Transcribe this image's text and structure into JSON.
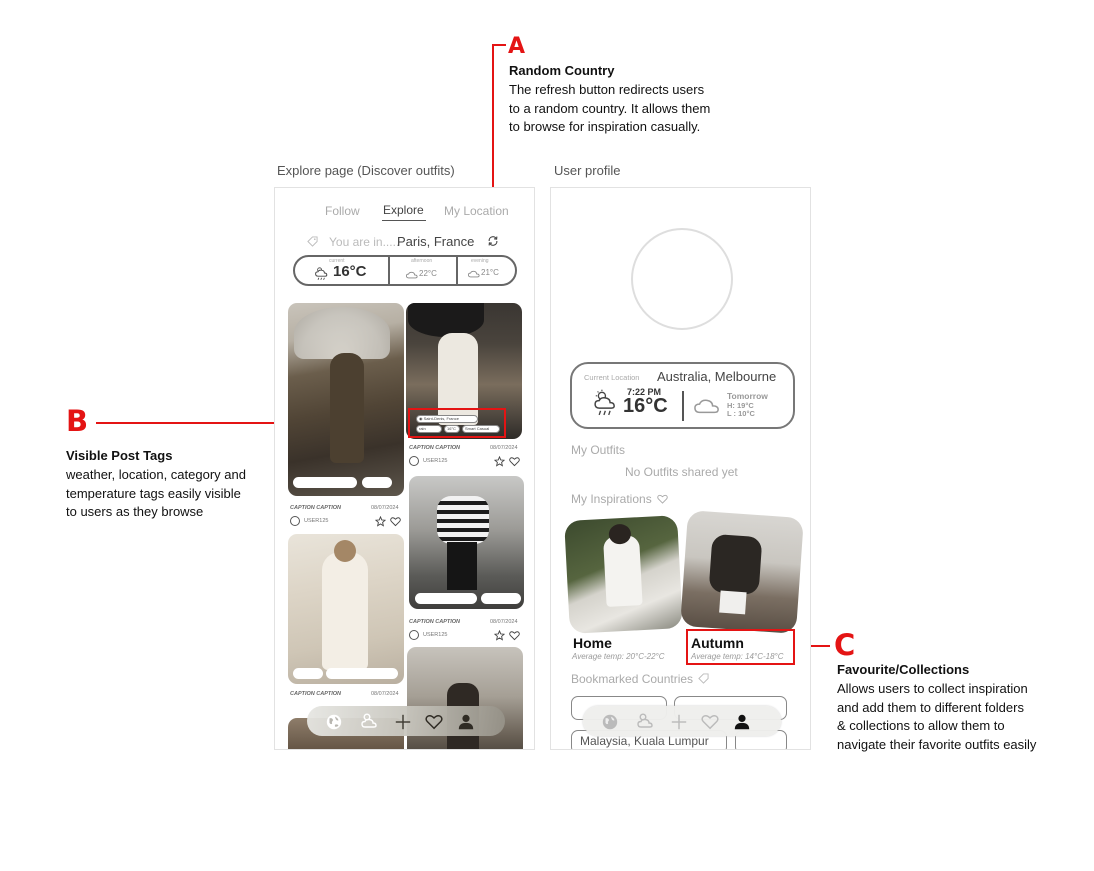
{
  "annotations": {
    "a": {
      "letter": "A",
      "title": "Random Country",
      "lines": [
        "The refresh button redirects users",
        "to a random country. It allows them",
        "to browse for inspiration casually."
      ]
    },
    "b": {
      "letter": "B",
      "title": "Visible Post Tags",
      "lines": [
        "weather, location, category and",
        "temperature tags easily visible",
        "to users as they browse"
      ]
    },
    "c": {
      "letter": "C",
      "title": "Favourite/Collections",
      "lines": [
        "Allows users to collect inspiration",
        "and add them to different folders",
        "& collections to allow them to",
        "navigate their favorite outfits easily"
      ]
    }
  },
  "explore": {
    "panel_label": "Explore page (Discover outfits)",
    "tabs": [
      "Follow",
      "Explore",
      "My Location"
    ],
    "location_prefix": "You are in.....",
    "location": "Paris, France",
    "weather": {
      "current_label": "current",
      "current_temp": "16°C",
      "afternoon_label": "afternoon",
      "afternoon_temp": "22°C",
      "evening_label": "evening",
      "evening_temp": "21°C"
    },
    "posts": [
      {
        "caption": "CAPTION CAPTION",
        "date": "08/07/2024",
        "user": "USER125"
      },
      {
        "caption": "CAPTION CAPTION",
        "date": "08/07/2024",
        "user": "USER125"
      },
      {
        "caption": "CAPTION CAPTION",
        "date": "08/07/2024",
        "user": "USER125"
      },
      {
        "caption": "CAPTION CAPTION",
        "date": "08/07/2024"
      }
    ],
    "post_tags": [
      "Saint-Denis, France",
      "rain",
      "16°C",
      "Smart Casual"
    ]
  },
  "profile": {
    "panel_label": "User profile",
    "current_location_label": "Current Location",
    "location": "Australia, Melbourne",
    "time": "7:22 PM",
    "temp": "16°C",
    "tomorrow_label": "Tomorrow",
    "tomorrow_high": "H: 19°C",
    "tomorrow_low": "L : 10°C",
    "my_outfits_label": "My Outfits",
    "no_outfits": "No Outfits shared yet",
    "my_inspirations_label": "My Inspirations",
    "collections": [
      {
        "name": "Home",
        "avg": "Average temp: 20°C-22°C"
      },
      {
        "name": "Autumn",
        "avg": "Average temp: 14°C-18°C"
      }
    ],
    "bookmarked_label": "Bookmarked Countries",
    "countries": [
      "Malaysia, Kuala Lumpur"
    ]
  },
  "colors": {
    "annotation": "#e41414",
    "border": "#777777",
    "muted": "#aaaaaa"
  }
}
